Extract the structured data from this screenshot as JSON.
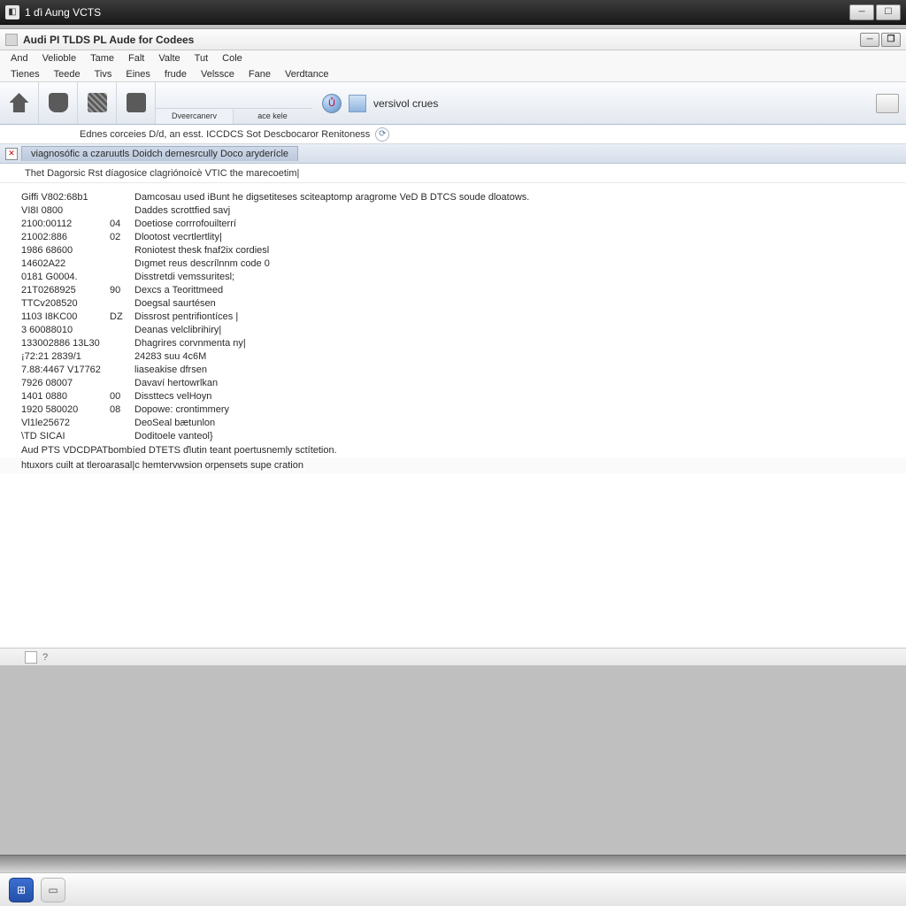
{
  "outer": {
    "title": "1 ďi Aung VCTS"
  },
  "inner": {
    "title": "Audi PI TLDS PL Aude for Codees"
  },
  "menu1": [
    "And",
    "Velioble",
    "Tame",
    "Falt",
    "Valte",
    "Tut",
    "Cole"
  ],
  "menu2": [
    "Tienes",
    "Teede",
    "Tivs",
    "Eines",
    "frude",
    "Velssce",
    "Fane",
    "Verdtance"
  ],
  "toolbar": {
    "tabs": [
      "Dveercanerv",
      "ace kele"
    ],
    "label": "versivol crues"
  },
  "filter": {
    "text": "Ednes corceies D/d,  an esst.   ICCDCS Sot Descbocaror Renitoness"
  },
  "tab": {
    "label": "viagnosófic a czaruutls Doidch dernesrcully Doco aryderícle"
  },
  "headerline": "Thet  Dagorsic  Rst díagosice clagriónoícѐ VTIC  the marecoetim|",
  "rows": [
    {
      "c1": "Giffi V802:68b1",
      "c2": "",
      "c3": "Damcosau used iBunt he digsetiteses sciteaptomp aragrome VeD B DTCS soude dloatows."
    },
    {
      "c1": "VI8I 0800",
      "c2": "",
      "c3": "Daddes scrottfied savj"
    },
    {
      "c1": "2100:00112",
      "c2": "04",
      "c3": "Doetiose corrrofouilterrí"
    },
    {
      "c1": "21002:886",
      "c2": "02",
      "c3": "Dlootost vecrtlertlity|"
    },
    {
      "c1": "1986 68600",
      "c2": "",
      "c3": "Roniotest thesk fnaf2ix  cordiesl"
    },
    {
      "c1": "14602A22",
      "c2": "",
      "c3": "Dıgmet reus descrílnnm  code 0"
    },
    {
      "c1": "0181 G0004.",
      "c2": "",
      "c3": "Disstretdi vemssuritesl;"
    },
    {
      "c1": "21T0268925",
      "c2": "90",
      "c3": "Dexcs a Teorittmeed"
    },
    {
      "c1": "TTCv208520",
      "c2": "",
      "c3": "Doegsal saurtésen"
    },
    {
      "c1": "1103 I8KC00",
      "c2": "DZ",
      "c3": "Dissrost pentrifiontíces |"
    },
    {
      "c1": "3 60088010",
      "c2": "",
      "c3": "Deanas velclibrihiry|"
    },
    {
      "c1": "133002886 13L30",
      "c2": "",
      "c3": "Dhagrires corvnmenta ny|"
    },
    {
      "c1": "¡72:21 2839/1",
      "c2": "",
      "c3": "24283 suu 4c6M"
    },
    {
      "c1": "7.88:4467 V17762",
      "c2": "",
      "c3": "liaseakise dfrsen"
    },
    {
      "c1": "7926 08007",
      "c2": "",
      "c3": "Davaví hertowrlkan"
    },
    {
      "c1": "1401 0880",
      "c2": "00",
      "c3": "Dissttecs velHoyn"
    },
    {
      "c1": "1920 580020",
      "c2": "08",
      "c3": "Dopowe: crontimmery"
    },
    {
      "c1": "Vl1le25672",
      "c2": "",
      "c3": "DeoSeal bætunlon"
    },
    {
      "c1": "\\TD SICAI",
      "c2": "",
      "c3": "Doditoele vanteol}"
    }
  ],
  "summary1": "Aud PTS VDCDPATbombíed DTETS ďlutin  teant poertusnemly sctítetion.",
  "summary2": "htuxors cuilt at tleroarasal|c hemtervwsion  orpensets supe cration",
  "status": "?",
  "colors": {
    "chrome_bg": "#e3e8ef"
  }
}
